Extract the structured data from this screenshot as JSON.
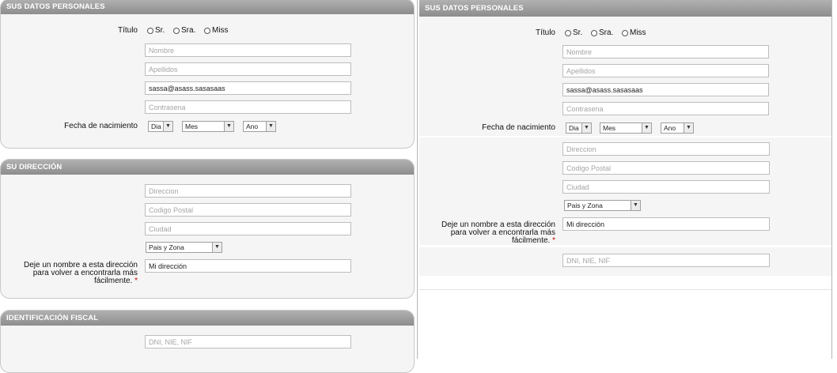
{
  "sections": {
    "personal": "SUS DATOS PERSONALES",
    "address": "SU DIRECCIÓN",
    "tax": "IDENTIFICACIÓN FISCAL"
  },
  "titulo": {
    "label": "Título",
    "options": [
      "Sr.",
      "Sra.",
      "Miss"
    ]
  },
  "fields": {
    "nombre_placeholder": "Nombre",
    "apellidos_placeholder": "Apellidos",
    "email_value": "sassa@asass.sasasaas",
    "contrasena_placeholder": "Contrasena",
    "direccion_placeholder": "Direccion",
    "codigo_postal_placeholder": "Codigo Postal",
    "ciudad_placeholder": "Ciudad",
    "alias_value": "Mi dirección",
    "fiscal_placeholder": "DNI, NIE, NIF"
  },
  "birth": {
    "label": "Fecha de nacimiento",
    "day": "Dia",
    "month": "Mes",
    "year": "Ano"
  },
  "pais": {
    "selected": "Pais y Zona"
  },
  "alias_label": {
    "line1": "Deje un nombre a esta dirección",
    "line2": "para volver a encontrarla más",
    "line3": "fácilmente.",
    "required_mark": "*"
  }
}
